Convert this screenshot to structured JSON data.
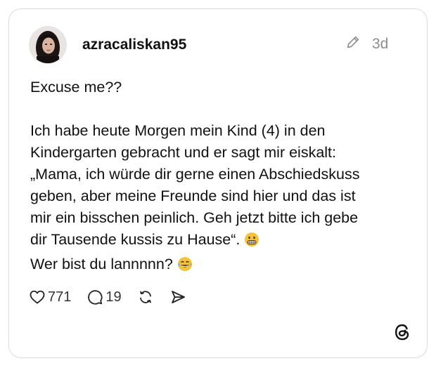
{
  "post": {
    "username": "azracaliskan95",
    "time": "3d",
    "lines": [
      "Excuse me??",
      "",
      "Ich habe heute Morgen mein Kind (4) in den",
      "Kindergarten gebracht und er sagt mir eiskalt:",
      "„Mama, ich würde dir gerne einen Abschiedskuss",
      "geben, aber meine Freunde sind hier und das ist",
      "mir ein bisschen peinlich. Geh jetzt bitte ich gebe",
      "dir Tausende kussis zu Hause“.",
      "Wer bist du lannnnn?"
    ],
    "emojis": [
      "grimacing-face-emoji",
      "tears-of-joy-emoji"
    ]
  },
  "actions": {
    "likes": "771",
    "replies": "19"
  },
  "icons": {
    "edit": "pencil-icon",
    "like": "heart-icon",
    "reply": "comment-bubble-icon",
    "repost": "repost-icon",
    "share": "send-icon",
    "brand": "threads-logo"
  },
  "colors": {
    "username": "#111111",
    "muted": "#8e8e8e",
    "border": "#dcdcdc",
    "emoji_yellow": "#f5c33b"
  }
}
